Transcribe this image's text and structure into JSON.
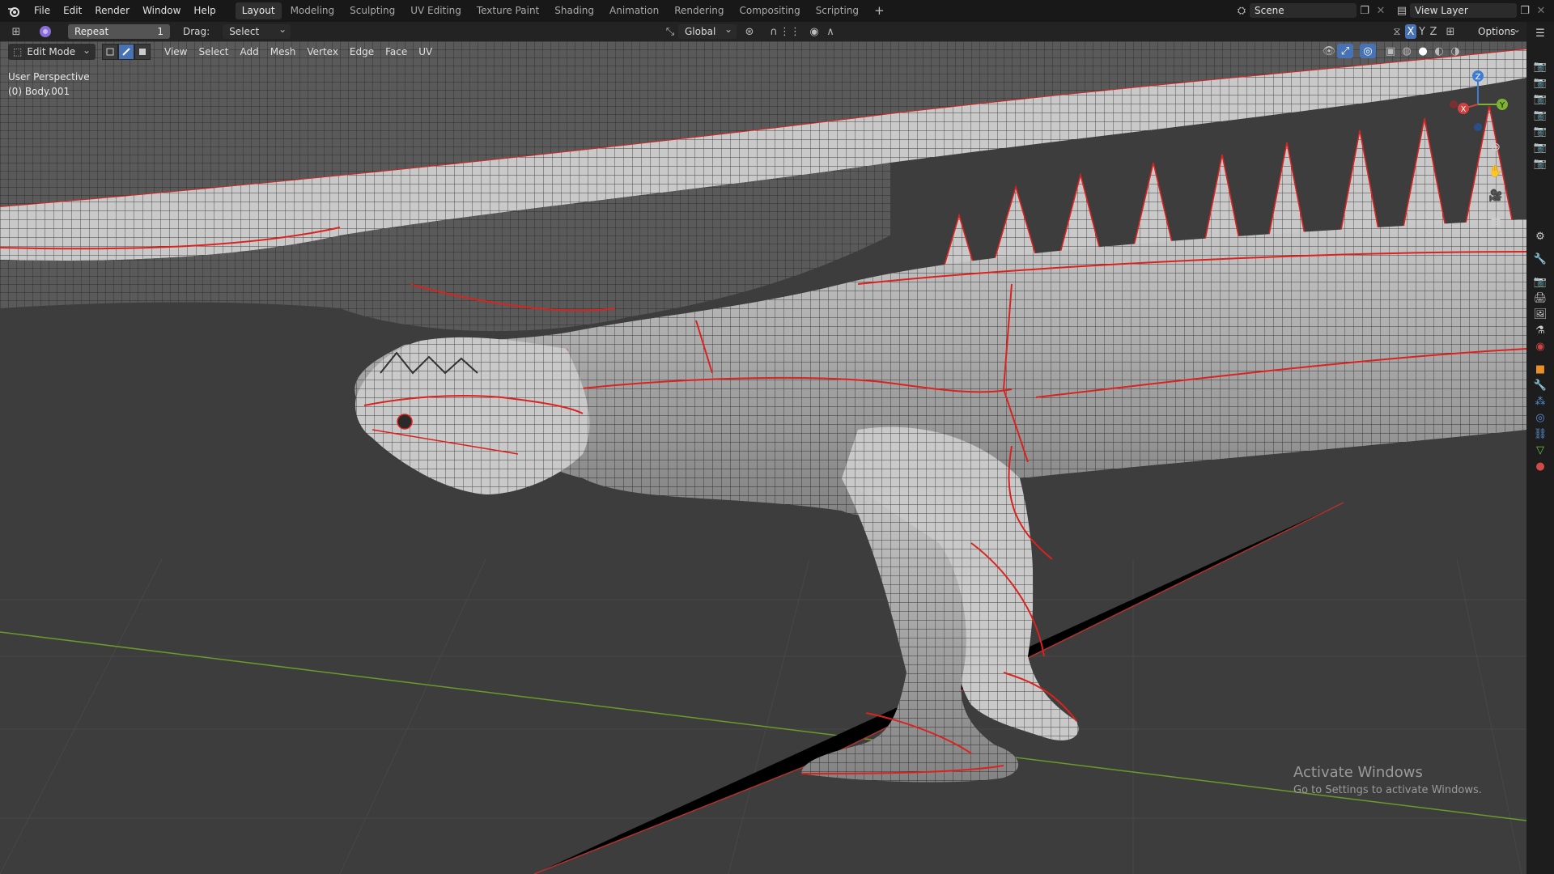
{
  "topbar": {
    "menus": [
      "File",
      "Edit",
      "Render",
      "Window",
      "Help"
    ],
    "tabs": [
      "Layout",
      "Modeling",
      "Sculpting",
      "UV Editing",
      "Texture Paint",
      "Shading",
      "Animation",
      "Rendering",
      "Compositing",
      "Scripting"
    ],
    "active_tab": "Layout",
    "add_tab": "+",
    "scene_label": "Scene",
    "view_layer_label": "View Layer"
  },
  "header2": {
    "repeat_label": "Repeat",
    "repeat_value": "1",
    "drag_label": "Drag:",
    "drag_value": "Select Box",
    "orientation": "Global",
    "axis_x": "X",
    "axis_y": "Y",
    "axis_z": "Z",
    "options_label": "Options"
  },
  "viewport_header": {
    "mode": "Edit Mode",
    "menus": [
      "View",
      "Select",
      "Add",
      "Mesh",
      "Vertex",
      "Edge",
      "Face",
      "UV"
    ]
  },
  "overlay": {
    "perspective": "User Perspective",
    "object": "(0) Body.001"
  },
  "gizmo": {
    "x": "X",
    "y": "Y",
    "z": "Z"
  },
  "watermark": {
    "title": "Activate Windows",
    "subtitle": "Go to Settings to activate Windows."
  },
  "colors": {
    "accent_blue": "#4772b3",
    "seam_red": "#d9231f",
    "axis_x_red": "#c3403f",
    "axis_y_green": "#6b9a2a"
  }
}
